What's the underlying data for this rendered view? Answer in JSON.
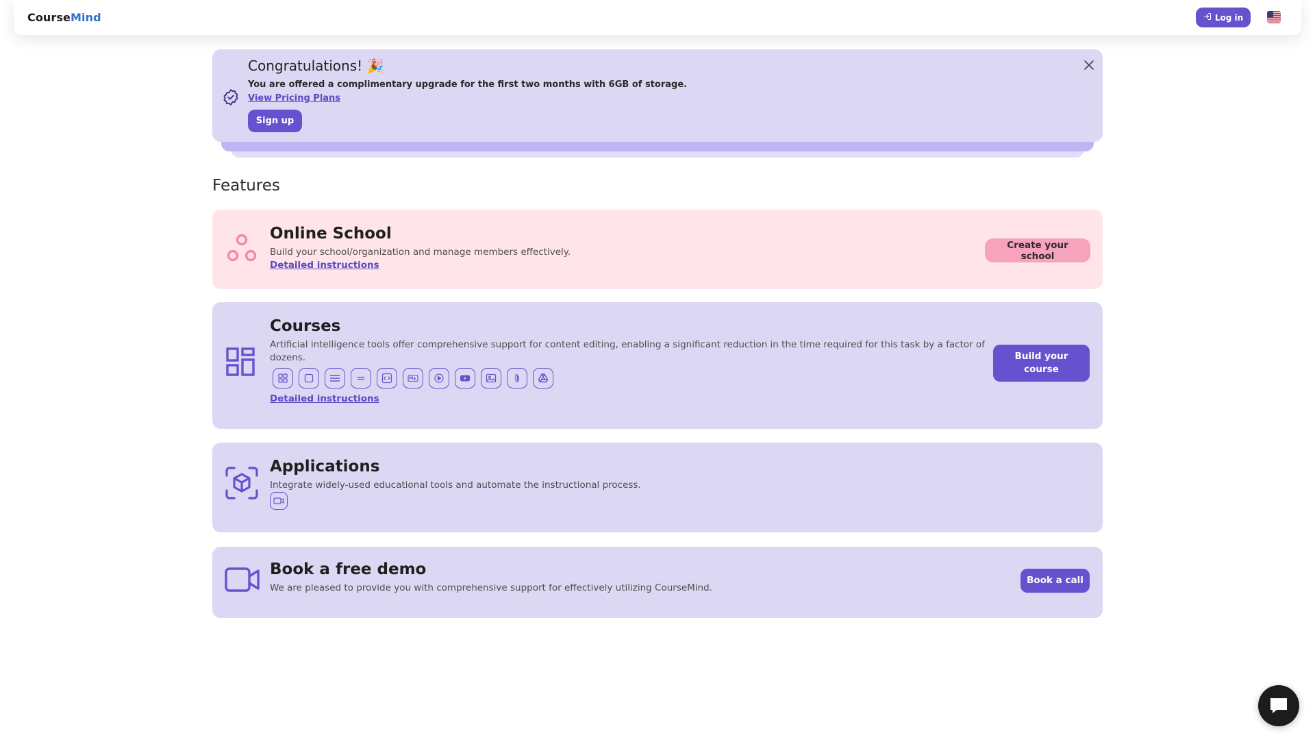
{
  "header": {
    "brand_part1": "Course",
    "brand_part2": "Mind",
    "login_label": "Log in",
    "language_icon": "us-flag-icon"
  },
  "banner": {
    "title": "Congratulations! 🎉",
    "text": "You are offered a complimentary upgrade for the first two months with 6GB of storage.",
    "link": "View Pricing Plans",
    "signup_label": "Sign up",
    "badge_icon": "verified-badge-icon",
    "close_icon": "close-icon"
  },
  "features": {
    "title": "Features",
    "cards": [
      {
        "title": "Online School",
        "desc": "Build your school/organization and manage members effectively.",
        "link": "Detailed instructions",
        "button": "Create your school",
        "icon": "three-circles-icon"
      },
      {
        "title": "Courses",
        "desc": "Artificial intelligence tools offer comprehensive support for content editing, enabling a significant reduction in the time required for this task by a factor of dozens.",
        "link": "Detailed instructions",
        "button": "Build your course",
        "icon": "dashboard-layout-icon",
        "tools": [
          "grid-icon",
          "square-icon",
          "lines-icon",
          "equals-icon",
          "code-icon",
          "markdown-icon",
          "play-circle-icon",
          "youtube-icon",
          "image-icon",
          "attachment-icon",
          "google-drive-icon"
        ]
      },
      {
        "title": "Applications",
        "desc": "Integrate widely-used educational tools and automate the instructional process.",
        "icon": "cube-scan-icon",
        "tools": [
          "video-call-icon"
        ]
      },
      {
        "title": "Book a free demo",
        "desc": "We are pleased to provide you with comprehensive support for effectively utilizing CourseMind.",
        "button": "Book a call",
        "icon": "video-camera-icon"
      }
    ]
  },
  "chat_icon": "chat-bubble-icon",
  "colors": {
    "accent": "#6651cf",
    "lavender": "#dcd8f4",
    "pink_card": "#ffe4ea",
    "pink_button": "#f7a3bd",
    "brand_blue": "#2f6fd1"
  }
}
